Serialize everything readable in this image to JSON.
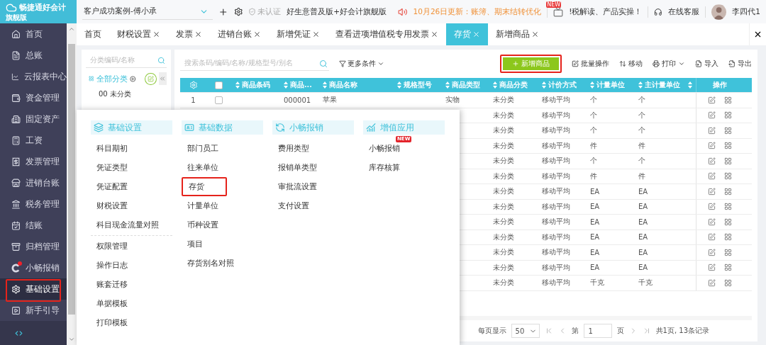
{
  "app": {
    "logo_text": "畅捷通好会计",
    "edition": "旗舰版"
  },
  "top_bar": {
    "account": "客户成功案例-傅小承",
    "verify_status": "未认证",
    "product": "好生意普及版+好会计旗舰版",
    "notice": "10月26日更新：账簿、期末结转优化",
    "video_badge": "NEW",
    "video_text": "!税解读、产品实操！",
    "support": "在线客服",
    "user": "李四代1"
  },
  "sidebar": {
    "items": [
      {
        "label": "首页",
        "selected": false,
        "highlighted": false,
        "notified": false
      },
      {
        "label": "总账",
        "selected": false,
        "highlighted": false,
        "notified": false
      },
      {
        "label": "云报表中心",
        "selected": false,
        "highlighted": false,
        "notified": false
      },
      {
        "label": "资金管理",
        "selected": false,
        "highlighted": false,
        "notified": false
      },
      {
        "label": "固定资产",
        "selected": false,
        "highlighted": false,
        "notified": false
      },
      {
        "label": "工资",
        "selected": false,
        "highlighted": false,
        "notified": false
      },
      {
        "label": "发票管理",
        "selected": false,
        "highlighted": false,
        "notified": false
      },
      {
        "label": "进销台账",
        "selected": false,
        "highlighted": false,
        "notified": false
      },
      {
        "label": "税务管理",
        "selected": false,
        "highlighted": false,
        "notified": false
      },
      {
        "label": "结账",
        "selected": false,
        "highlighted": false,
        "notified": false
      },
      {
        "label": "归档管理",
        "selected": false,
        "highlighted": false,
        "notified": false
      },
      {
        "label": "小畅报销",
        "selected": false,
        "highlighted": false,
        "notified": true
      },
      {
        "label": "基础设置",
        "selected": true,
        "highlighted": true,
        "notified": false
      },
      {
        "label": "新手引导",
        "selected": false,
        "highlighted": false,
        "notified": false
      }
    ]
  },
  "tabs": [
    {
      "label": "首页",
      "closable": false,
      "selected": false
    },
    {
      "label": "财税设置",
      "closable": true,
      "selected": false
    },
    {
      "label": "发票",
      "closable": true,
      "selected": false
    },
    {
      "label": "进销台账",
      "closable": true,
      "selected": false
    },
    {
      "label": "新增凭证",
      "closable": true,
      "selected": false
    },
    {
      "label": "查看进项增值税专用发票",
      "closable": true,
      "selected": false
    },
    {
      "label": "存货",
      "closable": true,
      "selected": true
    },
    {
      "label": "新增商品",
      "closable": true,
      "selected": false
    }
  ],
  "category_panel": {
    "search_placeholder": "分类编码/名称",
    "root": "全部分类",
    "items": [
      "00 未分类"
    ]
  },
  "toolbar": {
    "search_placeholder": "搜索条码/编码/名称/规格型号/别名",
    "filter": "更多条件",
    "buttons": [
      {
        "label": "新增商品",
        "kind": "primary",
        "highlighted": true
      },
      {
        "label": "批量操作",
        "kind": "edit"
      },
      {
        "label": "移动",
        "kind": "move"
      },
      {
        "label": "打印",
        "kind": "print-menu"
      },
      {
        "label": "导入",
        "kind": "import"
      },
      {
        "label": "导出",
        "kind": "export"
      }
    ]
  },
  "table": {
    "header_checked": false,
    "columns": [
      {
        "kind": "settings"
      },
      {
        "kind": "checkbox"
      },
      {
        "kind": "sort",
        "label": "商品条码"
      },
      {
        "kind": "sort",
        "label": "商品..."
      },
      {
        "kind": "sort",
        "label": "商品名称"
      },
      {
        "kind": "sort",
        "label": "规格型号"
      },
      {
        "kind": "sort",
        "label": "商品类型"
      },
      {
        "kind": "sort",
        "label": "商品分类"
      },
      {
        "kind": "sort",
        "label": "计价方式"
      },
      {
        "kind": "sort",
        "label": "计量单位"
      },
      {
        "kind": "sort",
        "label": "主计量单位"
      },
      {
        "kind": "sort"
      },
      {
        "kind": "plain",
        "label": "操作"
      }
    ],
    "rows": [
      {
        "index": "1",
        "checked": false,
        "code": "000001",
        "name": "苹果",
        "type": "实物",
        "category": "未分类",
        "pricing": "移动平均",
        "unit": "个",
        "main_unit": "个"
      },
      {
        "category": "未分类",
        "pricing": "移动平均",
        "unit": "个",
        "main_unit": "个"
      },
      {
        "category": "未分类",
        "pricing": "移动平均",
        "unit": "个",
        "main_unit": "个"
      },
      {
        "category": "未分类",
        "pricing": "移动平均",
        "unit": "件",
        "main_unit": "件"
      },
      {
        "category": "未分类",
        "pricing": "移动平均",
        "unit": "个",
        "main_unit": "个"
      },
      {
        "category": "未分类",
        "pricing": "移动平均",
        "unit": "件",
        "main_unit": "件"
      },
      {
        "category": "未分类",
        "pricing": "移动平均",
        "unit": "EA",
        "main_unit": "EA"
      },
      {
        "category": "未分类",
        "pricing": "移动平均",
        "unit": "EA",
        "main_unit": "EA"
      },
      {
        "category": "未分类",
        "pricing": "移动平均",
        "unit": "EA",
        "main_unit": "EA"
      },
      {
        "category": "未分类",
        "pricing": "移动平均",
        "unit": "EA",
        "main_unit": "EA"
      },
      {
        "category": "未分类",
        "pricing": "移动平均",
        "unit": "EA",
        "main_unit": "EA"
      },
      {
        "category": "未分类",
        "pricing": "移动平均",
        "unit": "EA",
        "main_unit": "EA"
      },
      {
        "category": "未分类",
        "pricing": "移动平均",
        "unit": "千克",
        "main_unit": "千克"
      }
    ]
  },
  "pagination": {
    "page_size_label": "每页显示",
    "page_size": "50",
    "page_prefix": "第",
    "page": "1",
    "page_suffix": "页",
    "summary": "共1页, 13条记录"
  },
  "menu": {
    "columns": [
      {
        "title": "基础设置",
        "groups": [
          [
            {
              "label": "科目期初",
              "highlighted": false
            },
            {
              "label": "凭证类型",
              "highlighted": false
            },
            {
              "label": "凭证配置",
              "highlighted": false
            },
            {
              "label": "财税设置",
              "highlighted": false
            },
            {
              "label": "科目现金流量对照",
              "highlighted": false
            }
          ],
          [
            {
              "label": "权限管理",
              "highlighted": false
            },
            {
              "label": "操作日志",
              "highlighted": false
            },
            {
              "label": "账套迁移",
              "highlighted": false
            },
            {
              "label": "单据模板",
              "highlighted": false
            },
            {
              "label": "打印模板",
              "highlighted": false
            }
          ]
        ]
      },
      {
        "title": "基础数据",
        "groups": [
          [
            {
              "label": "部门员工",
              "highlighted": false
            },
            {
              "label": "往来单位",
              "highlighted": false
            },
            {
              "label": "存货",
              "highlighted": true
            },
            {
              "label": "计量单位",
              "highlighted": false
            },
            {
              "label": "币种设置",
              "highlighted": false
            },
            {
              "label": "项目",
              "highlighted": false
            },
            {
              "label": "存货别名对照",
              "highlighted": false
            }
          ]
        ]
      },
      {
        "title": "小畅报销",
        "groups": [
          [
            {
              "label": "费用类型",
              "highlighted": false
            },
            {
              "label": "报销单类型",
              "highlighted": false
            },
            {
              "label": "审批流设置",
              "highlighted": false
            },
            {
              "label": "支付设置",
              "highlighted": false
            }
          ]
        ]
      },
      {
        "title": "增值应用",
        "groups": [
          [
            {
              "label": "小畅报销",
              "highlighted": false,
              "badge": "NEW"
            },
            {
              "label": "库存核算",
              "highlighted": false
            }
          ]
        ]
      }
    ]
  }
}
